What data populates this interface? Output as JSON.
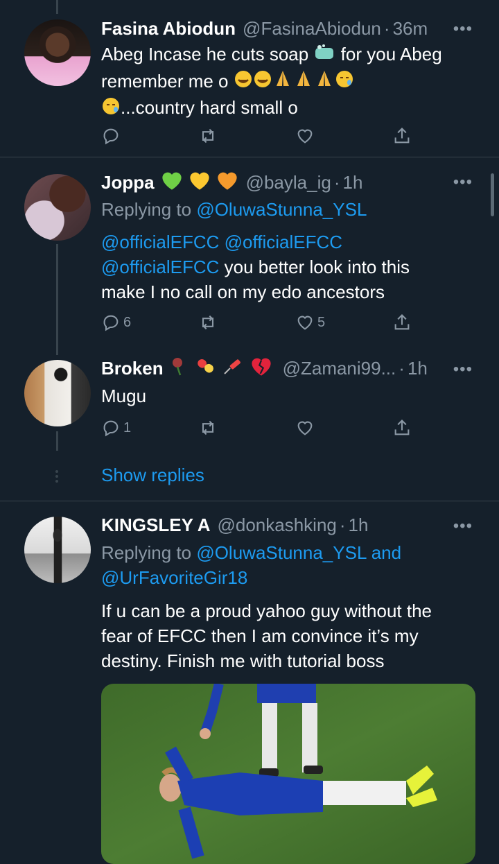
{
  "tweets": [
    {
      "name": "Fasina Abiodun",
      "handle": "@FasinaAbiodun",
      "time": "36m",
      "text_line1": "Abeg Incase he cuts soap",
      "text_line1b": "for you Abeg",
      "text_line2": "remember me o",
      "text_line3": "...country hard small o",
      "stats": {
        "replies": "",
        "retweets": "",
        "likes": ""
      }
    },
    {
      "name": "Joppa",
      "handle": "@bayla_ig",
      "time": "1h",
      "reply_prefix": "Replying to",
      "reply_to": "@OluwaStunna_YSL",
      "mention1": "@officialEFCC",
      "mention2": "@officialEFCC",
      "mention3": "@officialEFCC",
      "text_rest1": "you better look into this",
      "text_line2": "make I no call on my edo ancestors",
      "stats": {
        "replies": "6",
        "retweets": "",
        "likes": "5"
      }
    },
    {
      "name": "Broken",
      "handle": "@Zamani99...",
      "time": "1h",
      "text": "Mugu",
      "stats": {
        "replies": "1",
        "retweets": "",
        "likes": ""
      }
    },
    {
      "name": "KINGSLEY A",
      "handle": "@donkashking",
      "time": "1h",
      "reply_prefix": "Replying to",
      "reply_to": "@OluwaStunna_YSL",
      "reply_and": "and",
      "reply_to2": "@UrFavoriteGir18",
      "text_line1": "If u can be a proud yahoo guy without the",
      "text_line2": "fear of EFCC then I am convince it’s my",
      "text_line3": "destiny. Finish me with tutorial boss"
    }
  ],
  "show_replies": "Show replies",
  "separator_dot": "·",
  "more_glyph": "•••",
  "colors": {
    "background": "#15202b",
    "link": "#1d9bf0",
    "muted": "#8b98a5",
    "divider": "#38444d"
  }
}
